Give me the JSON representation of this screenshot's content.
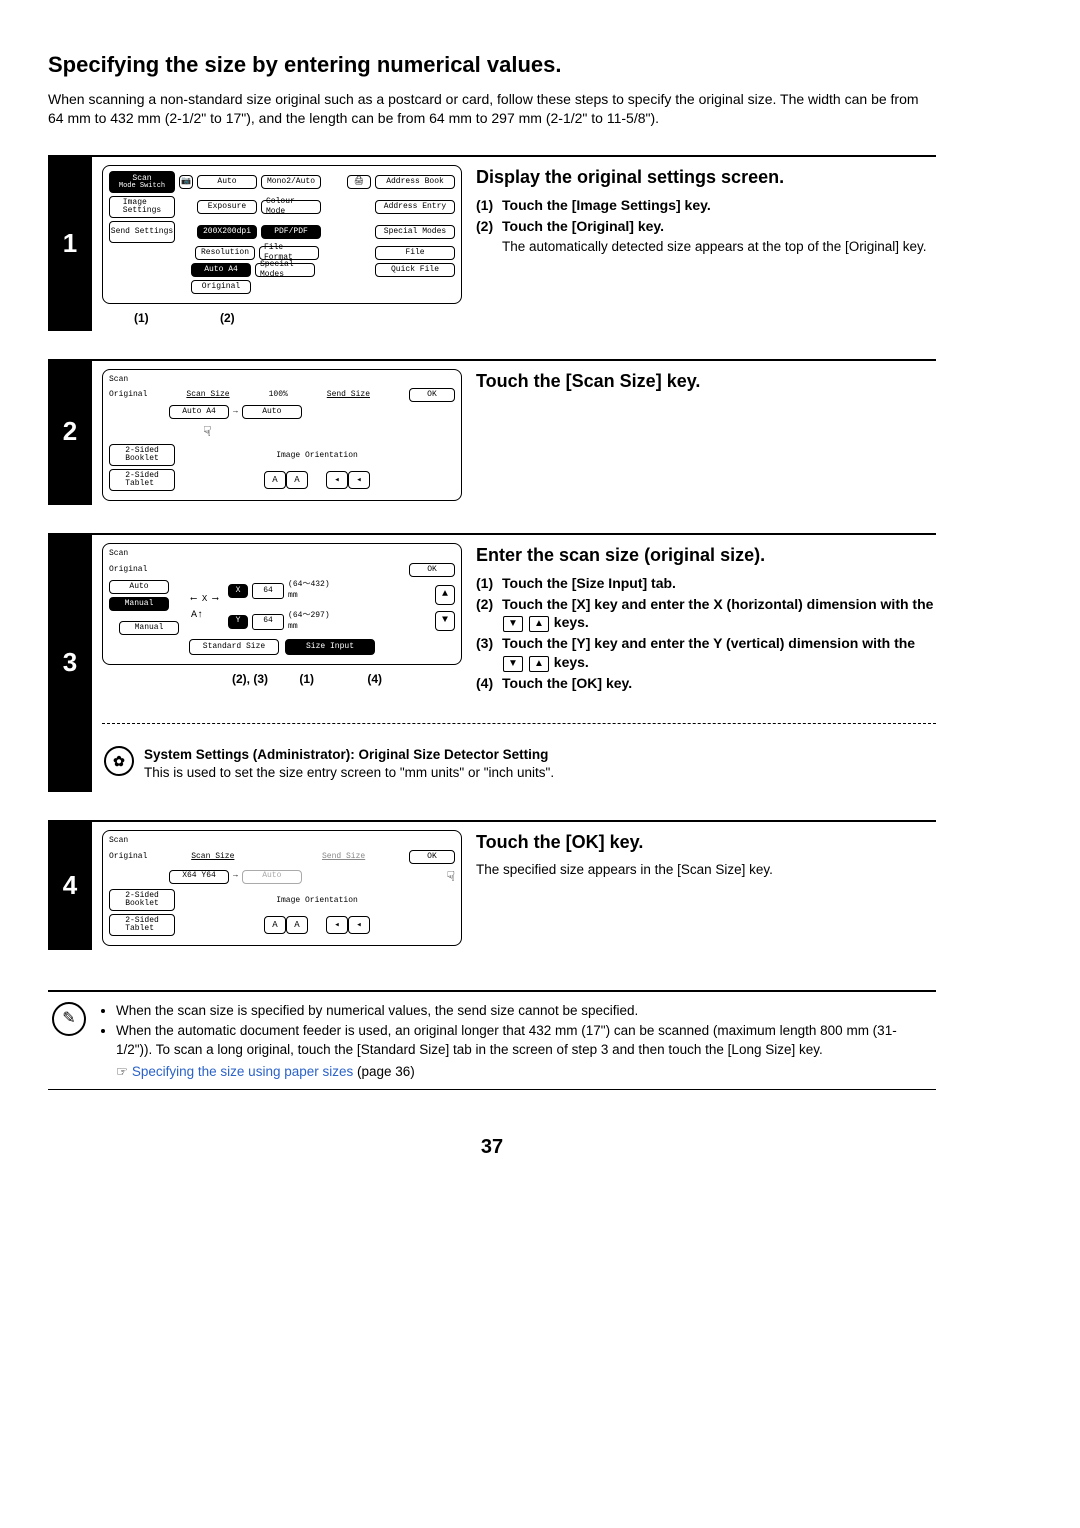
{
  "title": "Specifying the size by entering numerical values.",
  "intro": "When scanning a non-standard size original such as a postcard or card, follow these steps to specify the original size. The width can be from 64 mm to 432 mm (2-1/2\" to 17\"), and the length can be from 64 mm to 297 mm (2-1/2\" to 11-5/8\").",
  "steps": {
    "s1": {
      "num": "1",
      "head": "Display the original settings screen.",
      "sub1_num": "(1)",
      "sub1_txt": "Touch the [Image Settings] key.",
      "sub2_num": "(2)",
      "sub2_txt": "Touch the [Original] key.",
      "sub2_note": "The automatically detected size appears at the top of the [Original] key.",
      "cap1": "(1)",
      "cap2": "(2)",
      "panel": {
        "scan": "Scan",
        "mode": "Mode Switch",
        "image": "Image\nSettings",
        "send": "Send Settings",
        "auto": "Auto",
        "expo": "Exposure",
        "mono": "Mono2/Auto",
        "colour": "Colour Mode",
        "res": "200X200dpi",
        "resbtn": "Resolution",
        "pdf": "PDF/PDF",
        "ff": "File Format",
        "autoA4": "Auto   A4",
        "orig": "Original",
        "sm": "Special Modes",
        "book": "Address Book",
        "entry": "Address Entry",
        "smodes": "Special Modes",
        "file": "File",
        "qf": "Quick File"
      }
    },
    "s2": {
      "num": "2",
      "head": "Touch the [Scan Size] key.",
      "panel": {
        "scan": "Scan",
        "orig": "Original",
        "scansize": "Scan Size",
        "pct": "100%",
        "sendsize": "Send Size",
        "ok": "OK",
        "autoA4": "Auto   A4",
        "arrow": "→",
        "auto": "Auto",
        "b1": "2-Sided\nBooklet",
        "b2": "2-Sided\nTablet",
        "io": "Image Orientation"
      }
    },
    "s3": {
      "num": "3",
      "head": "Enter the scan size (original size).",
      "sub1_num": "(1)",
      "sub1_txt": "Touch the [Size Input] tab.",
      "sub2_num": "(2)",
      "sub2_pre": "Touch the [X] key and enter the X (horizontal) dimension with the ",
      "sub2_post": " keys.",
      "sub3_num": "(3)",
      "sub3_pre": "Touch the [Y] key and enter the Y (vertical) dimension with the ",
      "sub3_post": " keys.",
      "sub4_num": "(4)",
      "sub4_txt": "Touch the [OK] key.",
      "caps_23": "(2), (3)",
      "cap1": "(1)",
      "cap4": "(4)",
      "panel": {
        "scan": "Scan",
        "orig": "Original",
        "ok": "OK",
        "auto": "Auto",
        "manual": "Manual",
        "manual2": "Manual",
        "x": "X",
        "y": "Y",
        "v": "64",
        "xr": "(64～432)\nmm",
        "yr": "(64～297)\nmm",
        "std": "Standard Size",
        "sizein": "Size Input"
      },
      "admin_head": "System Settings (Administrator): Original Size Detector Setting",
      "admin_txt": "This is used to set the size entry screen to \"mm units\" or \"inch units\"."
    },
    "s4": {
      "num": "4",
      "head": "Touch the [OK] key.",
      "note": "The specified size appears in the [Scan Size] key.",
      "panel": {
        "scan": "Scan",
        "orig": "Original",
        "scansize": "Scan Size",
        "sendsize": "Send Size",
        "ok": "OK",
        "x64": "X64 Y64",
        "arrow": "→",
        "auto": "Auto",
        "b1": "2-Sided\nBooklet",
        "b2": "2-Sided\nTablet",
        "io": "Image Orientation"
      }
    }
  },
  "notes": {
    "n1": "When the scan size is specified by numerical values, the send size cannot be specified.",
    "n2": "When the automatic document feeder is used, an original longer that 432 mm (17\") can be scanned (maximum length 800 mm (31-1/2\")). To scan a long original, touch the [Standard Size] tab in the screen of step 3 and then touch the [Long Size] key.",
    "xref_sym": "☞",
    "xref_link": "Specifying the size using paper sizes",
    "xref_page": " (page 36)"
  },
  "pagenum": "37"
}
